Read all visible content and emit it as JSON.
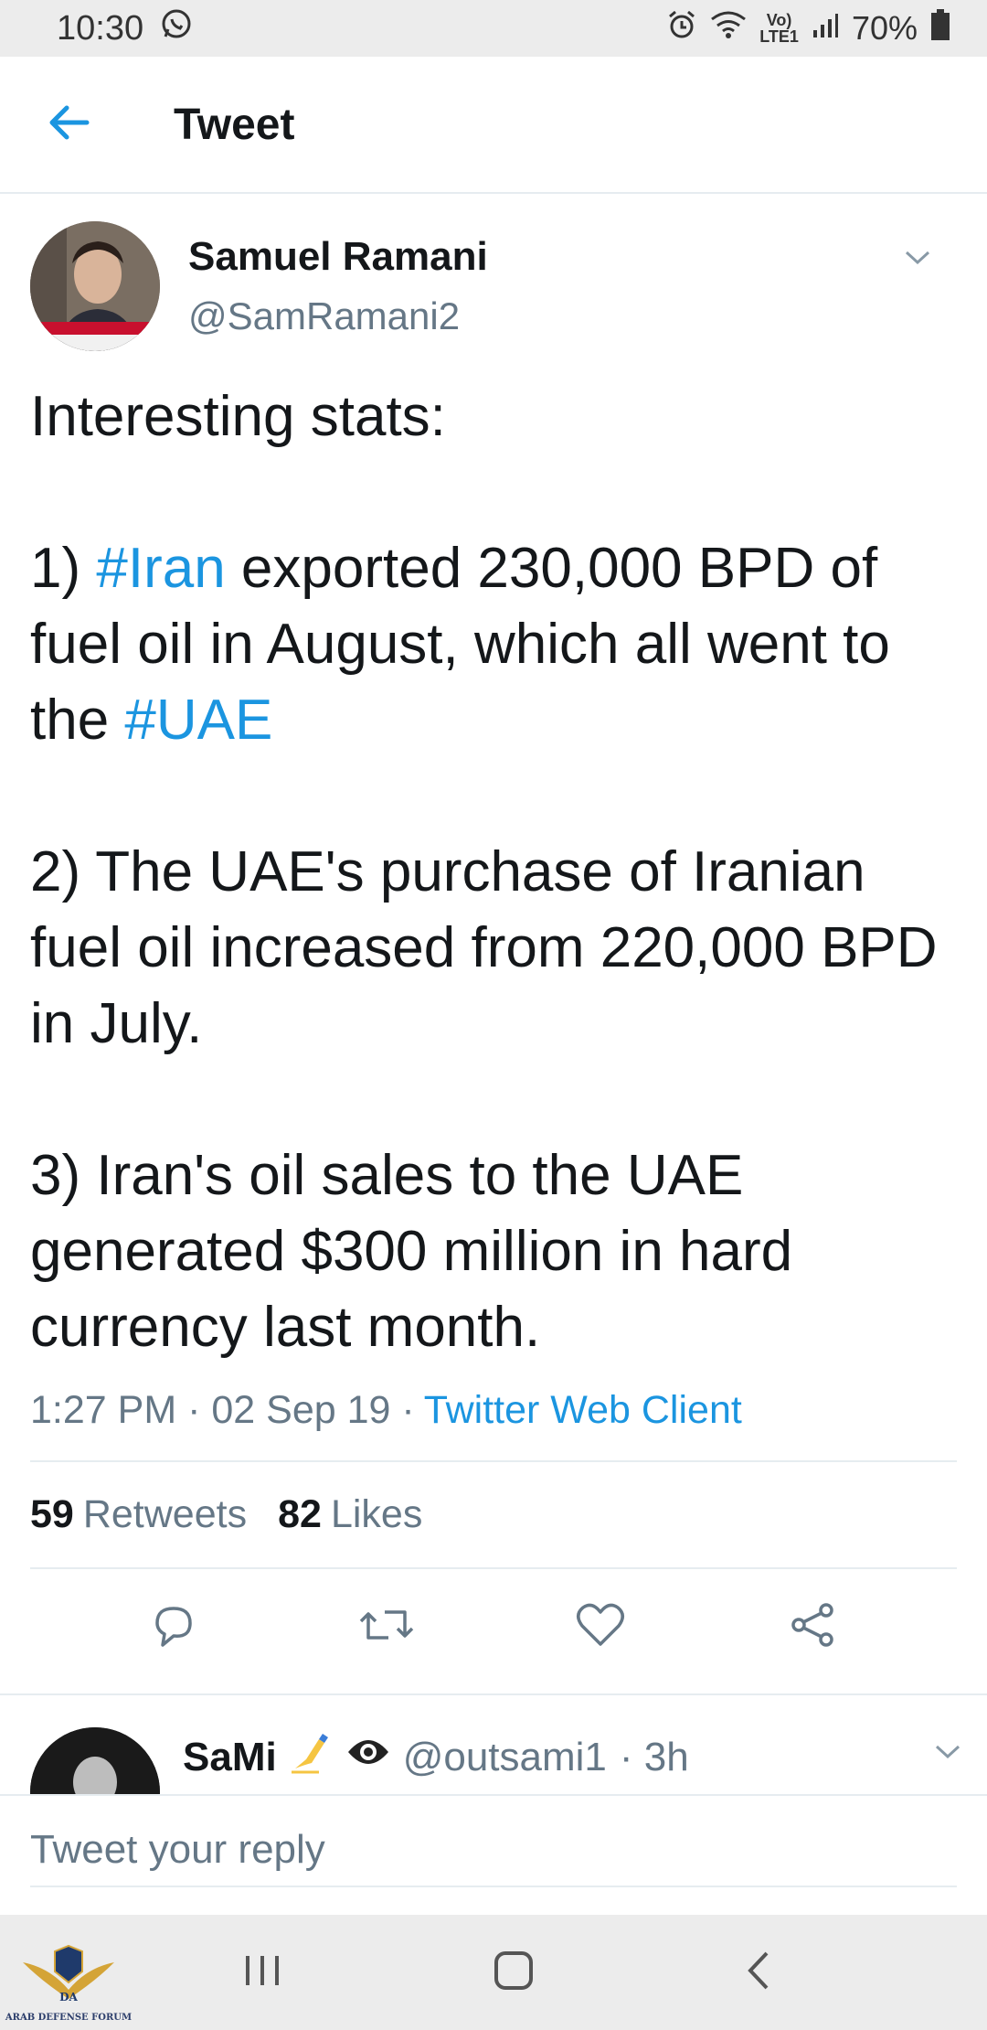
{
  "status_bar": {
    "time": "10:30",
    "network_top": "Vo)",
    "network_bottom": "LTE1",
    "battery": "70%"
  },
  "header": {
    "title": "Tweet"
  },
  "tweet": {
    "author_name": "Samuel Ramani",
    "author_handle": "@SamRamani2",
    "text_parts": [
      "Interesting stats:\n\n1) ",
      "#Iran",
      " exported 230,000 BPD of fuel oil in August, which all went to the ",
      "#UAE",
      "\n\n2) The UAE's purchase of Iranian fuel oil increased from 220,000 BPD in July.\n\n3) Iran's oil sales to the UAE generated $300 million in hard currency last month."
    ],
    "time": "1:27 PM",
    "date": "02 Sep 19",
    "separator": "·",
    "client": "Twitter Web Client",
    "retweets_count": "59",
    "retweets_label": "Retweets",
    "likes_count": "82",
    "likes_label": "Likes"
  },
  "reply_preview": {
    "name": "SaMi",
    "handle": "@outsami1",
    "time": "· 3h"
  },
  "reply_bar": {
    "placeholder": "Tweet your reply"
  },
  "watermark": {
    "logo_text": "DA",
    "forum_name": "ARAB DEFENSE FORUM"
  },
  "colors": {
    "accent": "#1b95e0",
    "secondary_text": "#657786",
    "divider": "#e6ecf0"
  }
}
